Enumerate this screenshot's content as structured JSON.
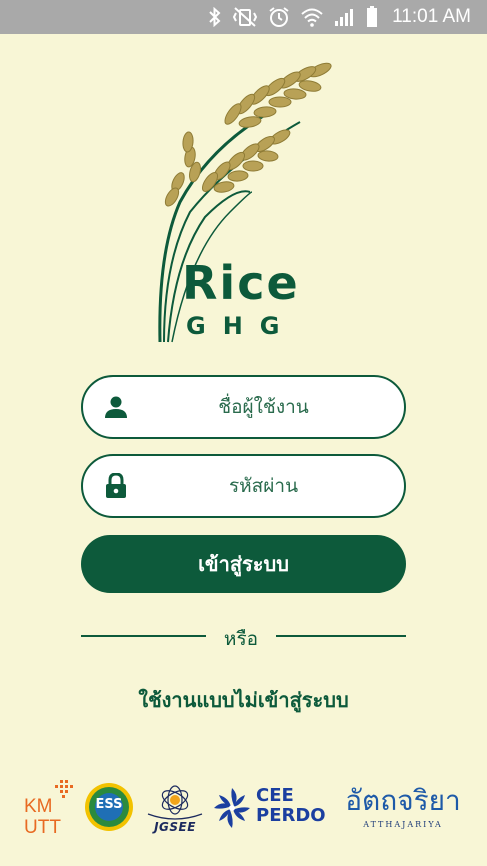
{
  "status_bar": {
    "time": "11:01 AM",
    "icons": [
      "bluetooth-icon",
      "vibrate-icon",
      "alarm-icon",
      "wifi-icon",
      "signal-icon",
      "battery-icon"
    ]
  },
  "logo": {
    "title": "Rice",
    "subtitle": "GHG"
  },
  "login_form": {
    "username_placeholder": "ชื่อผู้ใช้งาน",
    "password_placeholder": "รหัสผ่าน",
    "login_label": "เข้าสู่ระบบ",
    "or_label": "หรือ",
    "guest_label": "ใช้งานแบบไม่เข้าสู่ระบบ"
  },
  "partners": {
    "kmutt_top": "KM",
    "kmutt_bottom": "UTT",
    "ess": "ESS",
    "jgsee": "JGSEE",
    "cee_line1": "CEE",
    "cee_line2": "PERDO",
    "attha_thai": "อัตถจริยา",
    "attha_latin": "ATTHAJARIYA"
  },
  "colors": {
    "background": "#f8f6d6",
    "primary": "#0d5a3b",
    "status_bar": "#a9a9a9",
    "grain": "#b8a156"
  }
}
